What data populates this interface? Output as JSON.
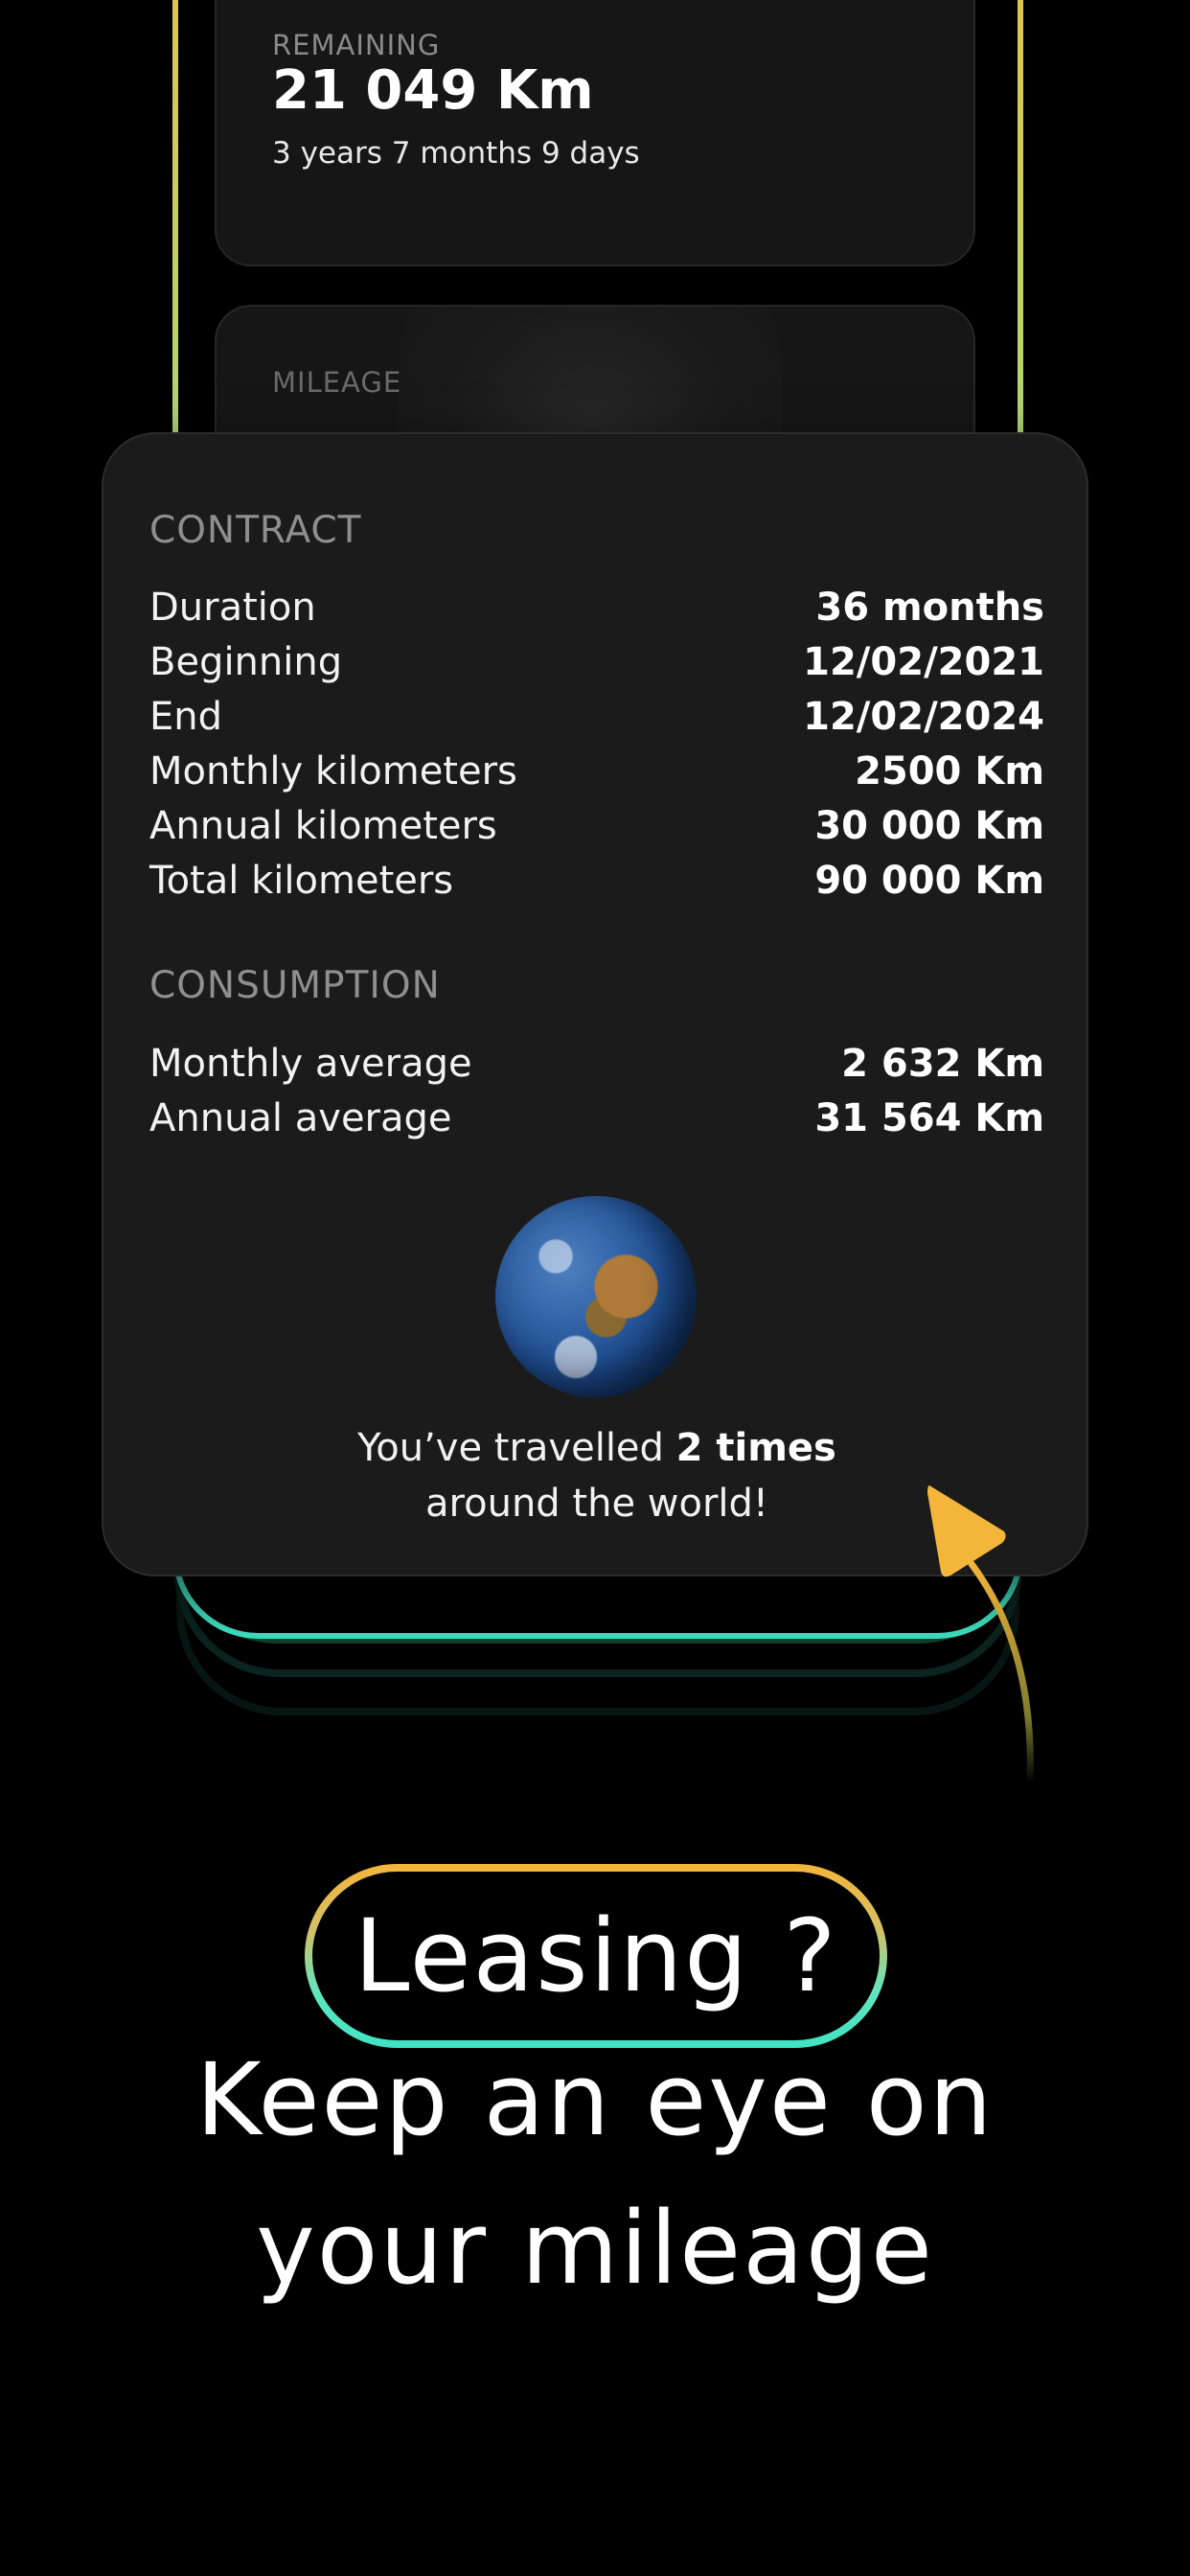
{
  "remaining": {
    "label": "REMAINING",
    "value": "21 049 Km",
    "subtitle": "3 years 7 months 9 days"
  },
  "mileage": {
    "label": "MILEAGE"
  },
  "contract": {
    "title": "CONTRACT",
    "rows": [
      {
        "label": "Duration",
        "value": "36 months"
      },
      {
        "label": "Beginning",
        "value": "12/02/2021"
      },
      {
        "label": "End",
        "value": "12/02/2024"
      },
      {
        "label": "Monthly kilometers",
        "value": "2500 Km"
      },
      {
        "label": "Annual kilometers",
        "value": "30 000 Km"
      },
      {
        "label": "Total kilometers",
        "value": "90 000 Km"
      }
    ]
  },
  "consumption": {
    "title": "CONSUMPTION",
    "rows": [
      {
        "label": "Monthly average",
        "value": "2 632 Km"
      },
      {
        "label": "Annual average",
        "value": "31 564 Km"
      }
    ]
  },
  "world": {
    "prefix": "You’ve travelled ",
    "times": "2 times",
    "suffix": "around the world!"
  },
  "headline": {
    "pill": "Leasing ?",
    "line1": "Keep an eye on",
    "line2": "your mileage"
  },
  "colors": {
    "background": "#000000",
    "card": "#1b1b1b",
    "accent_yellow": "#f3b53a",
    "accent_teal": "#3fe3c2"
  },
  "icons": {
    "globe": "earth-globe-icon",
    "arrow": "curved-arrow-icon"
  }
}
